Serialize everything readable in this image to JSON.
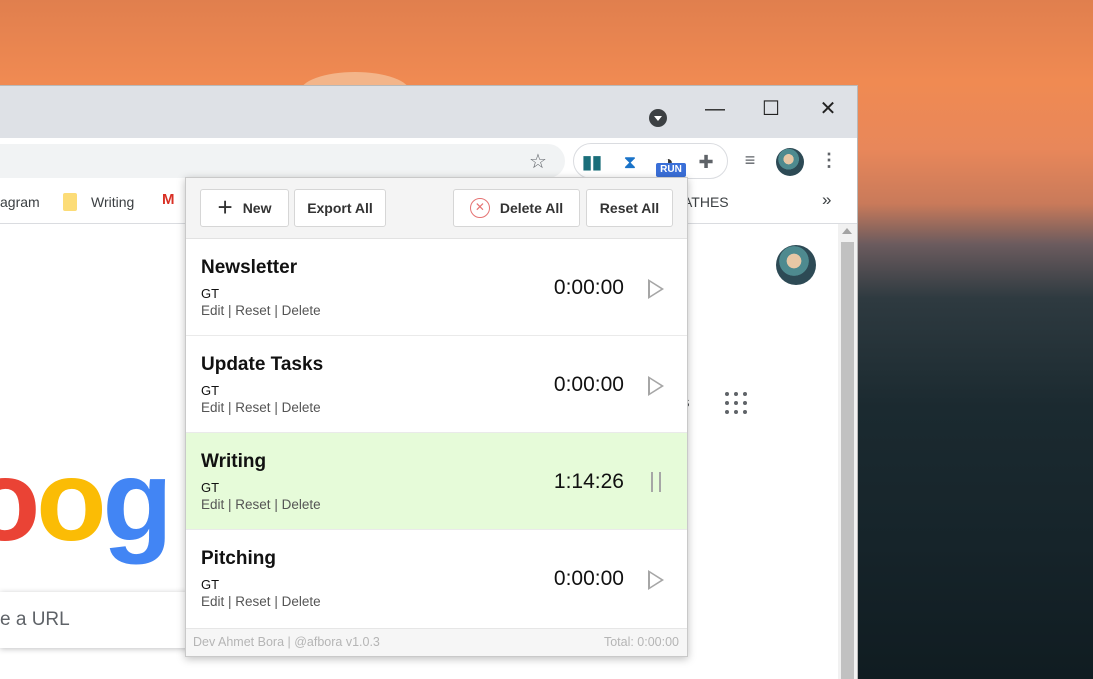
{
  "browser": {
    "window_controls": {
      "minimize": "—",
      "maximize": "☐",
      "close": "✕"
    },
    "bookmarks": [
      {
        "label": "agram"
      },
      {
        "label": "Writing"
      },
      {
        "label": "ATHES"
      }
    ],
    "bookmarks_more": "»",
    "search_placeholder": "e a URL",
    "logo_text": "oog",
    "header_partial": "s",
    "run_badge": "RUN"
  },
  "popup": {
    "buttons": {
      "new": "New",
      "export_all": "Export All",
      "delete_all": "Delete All",
      "reset_all": "Reset All"
    },
    "tasks": [
      {
        "title": "Newsletter",
        "tag": "GT",
        "time": "0:00:00",
        "state": "stopped"
      },
      {
        "title": "Update Tasks",
        "tag": "GT",
        "time": "0:00:00",
        "state": "stopped"
      },
      {
        "title": "Writing",
        "tag": "GT",
        "time": "1:14:26",
        "state": "running"
      },
      {
        "title": "Pitching",
        "tag": "GT",
        "time": "0:00:00",
        "state": "stopped"
      }
    ],
    "task_actions": {
      "edit": "Edit",
      "reset": "Reset",
      "delete": "Delete",
      "sep": " | "
    },
    "footer": {
      "credit": "Dev Ahmet Bora | @afbora v1.0.3",
      "total": "Total: 0:00:00"
    }
  },
  "colors": {
    "active_row": "#e6fbd9",
    "delete_accent": "#e57373",
    "run_badge": "#3a6fd8"
  }
}
